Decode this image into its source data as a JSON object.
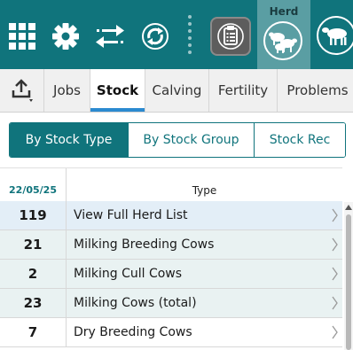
{
  "header": {
    "herd_tab_label": "Herd",
    "accent_color": "#10747c",
    "icons": [
      "grid-icon",
      "gear-icon",
      "transfer-arrows-icon",
      "sync-icon",
      "more-vertical-icon",
      "clipboard-list-icon",
      "herd-icon",
      "cow-icon"
    ]
  },
  "tabs": [
    {
      "label": "Jobs",
      "active": false
    },
    {
      "label": "Stock",
      "active": true
    },
    {
      "label": "Calving",
      "active": false
    },
    {
      "label": "Fertility",
      "active": false
    },
    {
      "label": "Problems",
      "active": false
    }
  ],
  "segmented": [
    {
      "label": "By Stock Type",
      "active": true
    },
    {
      "label": "By Stock Group",
      "active": false
    },
    {
      "label": "Stock Rec",
      "active": false
    }
  ],
  "table": {
    "date_header": "22/05/25",
    "type_header": "Type",
    "rows": [
      {
        "count": "119",
        "label": "View Full Herd List"
      },
      {
        "count": "21",
        "label": "Milking Breeding Cows"
      },
      {
        "count": "2",
        "label": "Milking Cull Cows"
      },
      {
        "count": "23",
        "label": "Milking Cows (total)"
      },
      {
        "count": "7",
        "label": "Dry Breeding Cows"
      }
    ]
  }
}
